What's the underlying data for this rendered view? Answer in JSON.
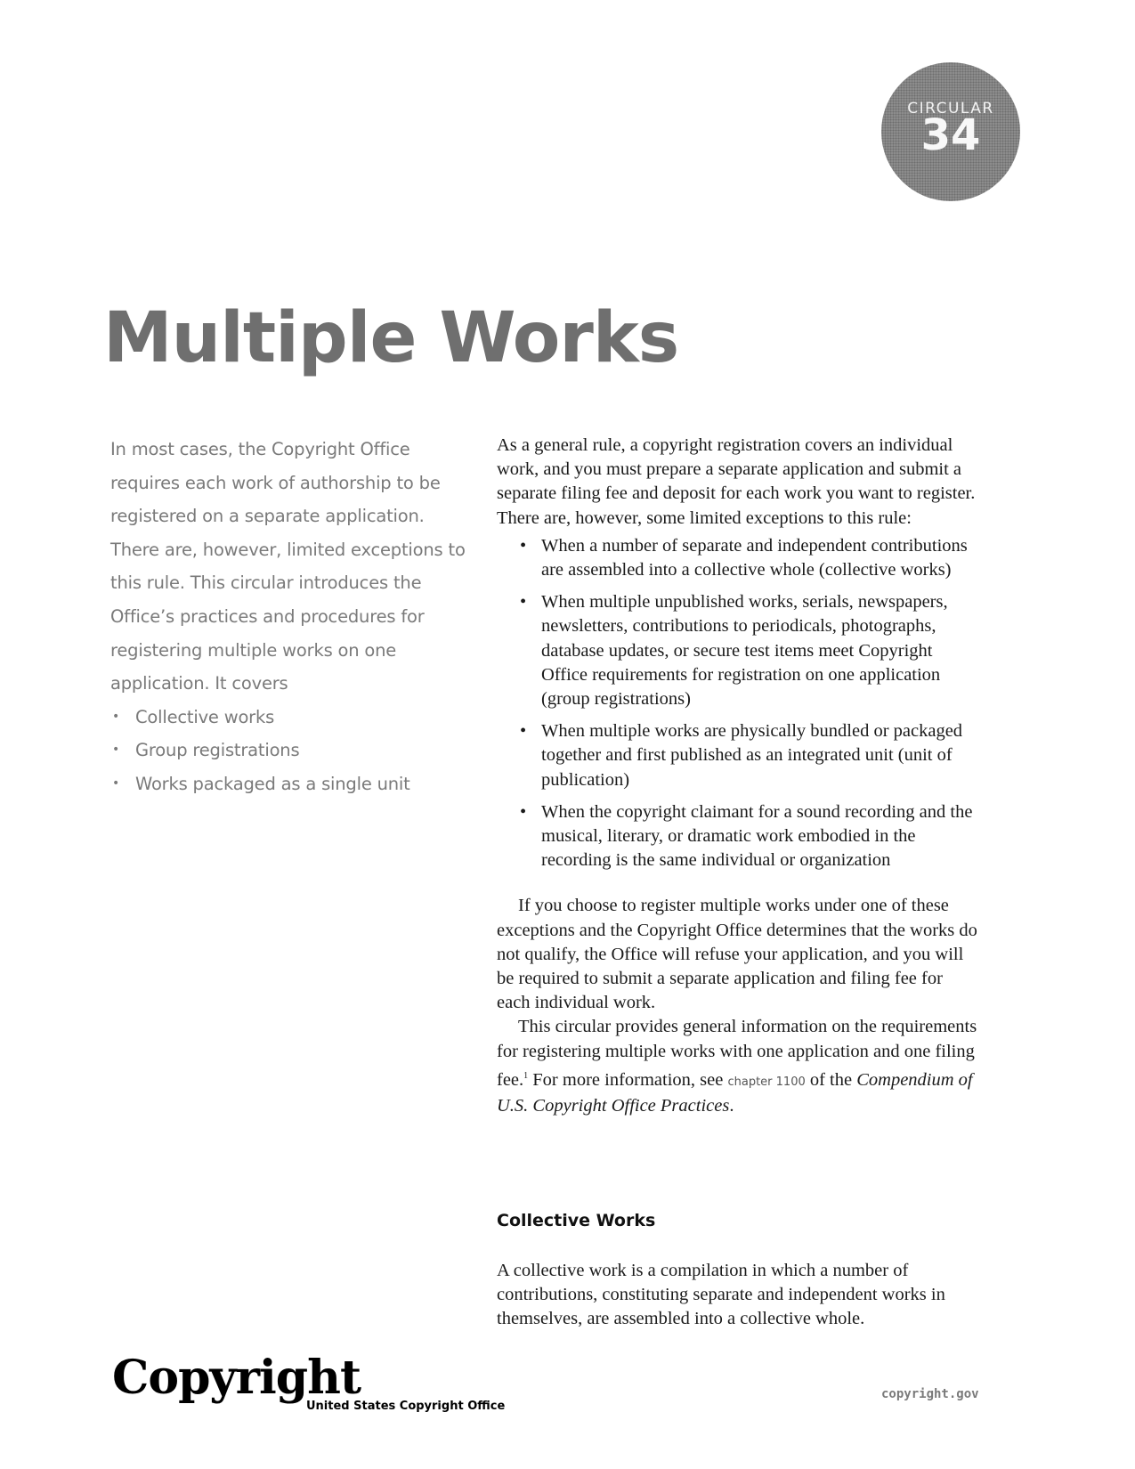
{
  "badge": {
    "label": "CIRCULAR",
    "number": "34"
  },
  "title": "Multiple Works",
  "intro": {
    "text": "In most cases, the Copyright Office requires each work of authorship to be registered on a separate application. There are, however, limited exceptions to this rule. This circular introduces the Office’s practices and procedures for registering multiple works on one application. It covers",
    "bullets": [
      "Collective works",
      "Group registrations",
      "Works packaged as a single unit"
    ]
  },
  "body": {
    "para1": "As a general rule, a copyright registration covers an individual work, and you must prepare a separate application and submit a separate filing fee and deposit for each work you want to register. There are, however, some limited exceptions to this rule:",
    "exceptions": [
      "When a number of separate and independent contribu­tions are assembled into a collective whole (collective works)",
      "When multiple unpublished works, serials, newspapers, newsletters, contributions to periodicals, photographs, database updates, or secure test items meet Copyright Office requirements for registration on one application (group registrations)",
      "When multiple works are physically bundled or pack­aged together and first published as an integrated unit (unit of publication)",
      "When the copyright claimant for a sound recording and the musical, literary, or dramatic work embodied in the recording is the same individual or organization"
    ],
    "para2": "If you choose to register multiple works under one of these exceptions and the Copyright Office determines that the works do not qualify, the Office will refuse your application, and you will be required to submit a separate application and filing fee for each individual work.",
    "para3_start": "This circular provides general information on the require­ments for registering multiple works with one application and one filing fee.",
    "footnote_marker": "1",
    "para3_mid": " For more information, see ",
    "chapter_link": "chapter 1100",
    "para3_after_link": " of the ",
    "compendium_title": "Compendium of U.S. Copyright Office Practices",
    "para3_end": "."
  },
  "section": {
    "heading": "Collective Works",
    "text": "A collective work is a compilation in which a number of contributions, constituting separate and independent works in themselves, are assembled into a collective whole."
  },
  "footer": {
    "logo_text": "Copyright",
    "logo_subtitle": "United States Copyright Office",
    "url": "copyright.gov"
  },
  "bullet_glyph": "•"
}
